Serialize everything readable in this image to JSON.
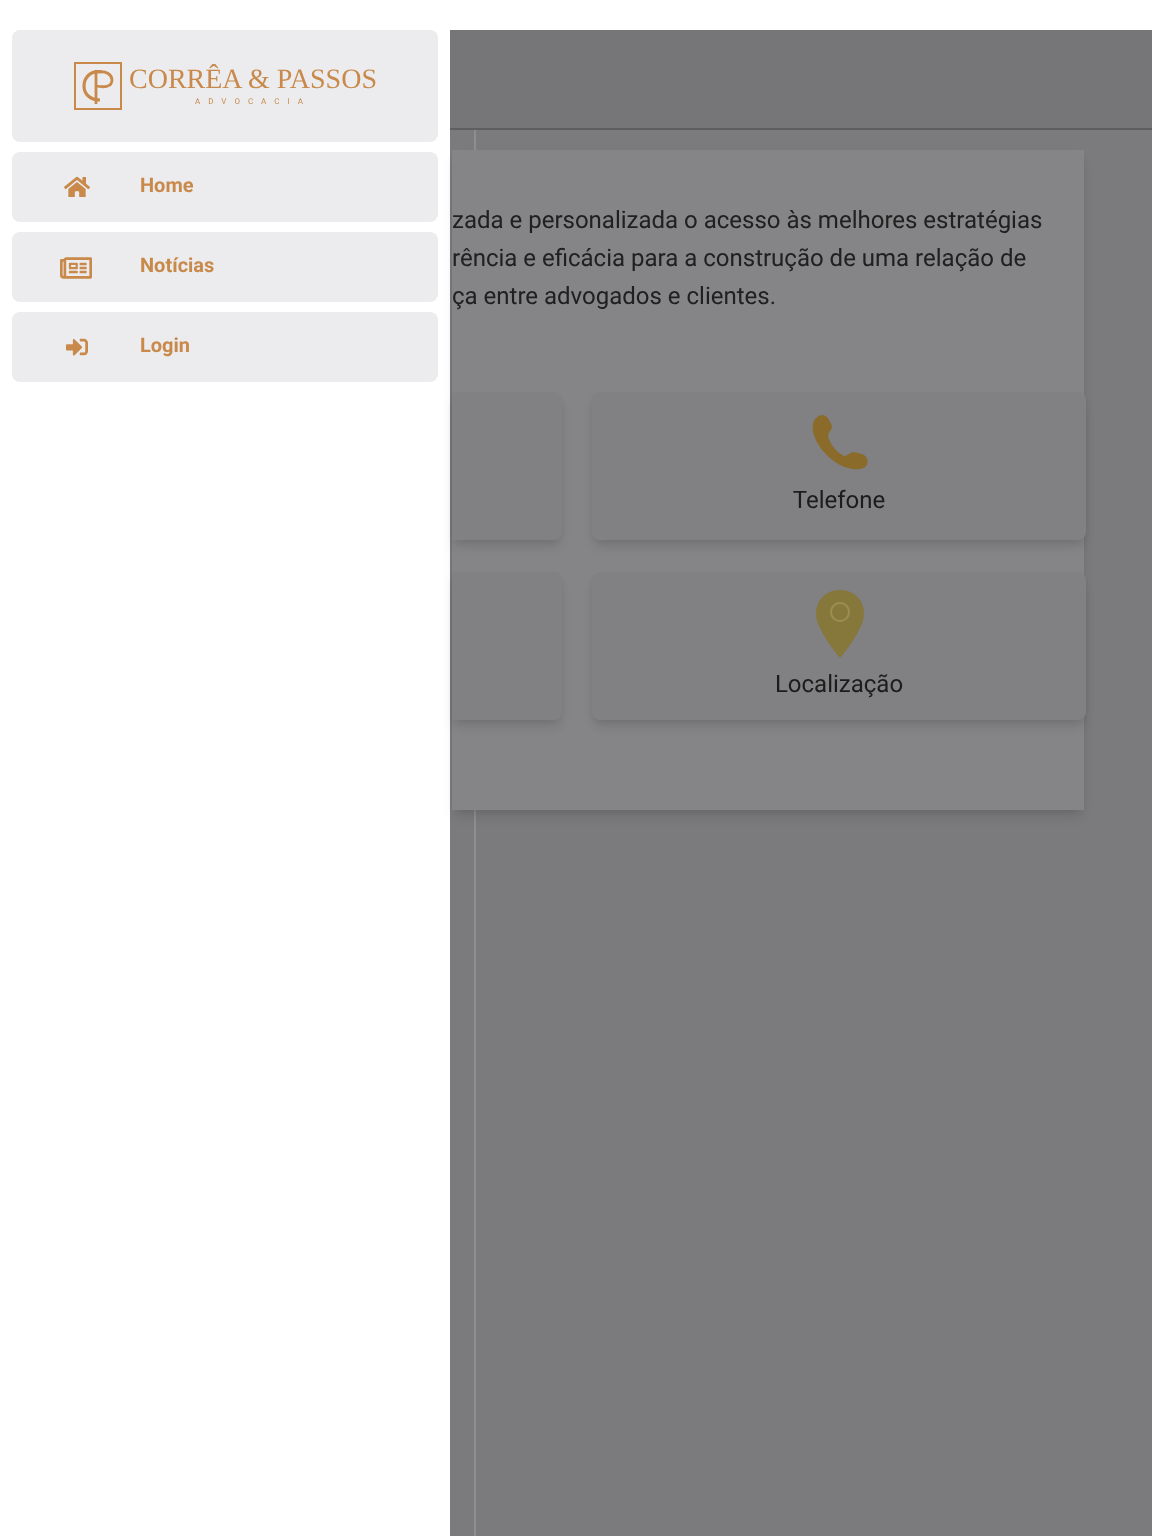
{
  "drawer": {
    "logo": {
      "title": "CORRÊA & PASSOS",
      "subtitle": "ADVOCACIA"
    },
    "items": [
      {
        "kind": "home",
        "label": "Home"
      },
      {
        "kind": "news",
        "label": "Notícias"
      },
      {
        "kind": "login",
        "label": "Login"
      }
    ]
  },
  "page": {
    "intro_lines": [
      "zada e personalizada o acesso às melhores estratégias",
      "rência e eficácia para a construção de uma relação de",
      "ça entre advogados e clientes."
    ],
    "tiles": [
      {
        "kind": "blank"
      },
      {
        "kind": "phone",
        "label": "Telefone"
      },
      {
        "kind": "blank"
      },
      {
        "kind": "pin",
        "label": "Localização"
      }
    ]
  }
}
